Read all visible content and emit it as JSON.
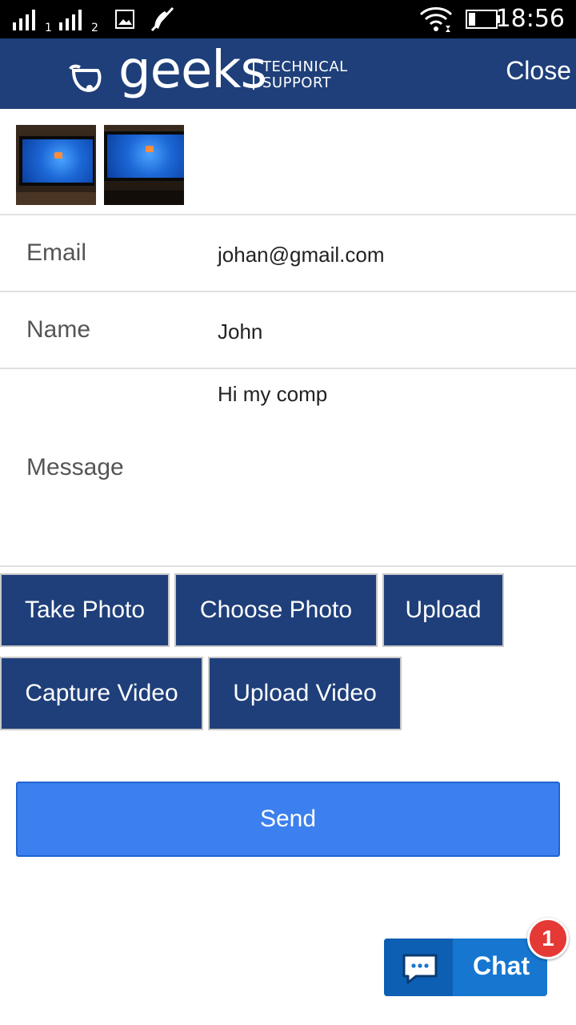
{
  "status_bar": {
    "sim1_label": "1",
    "sim2_label": "2",
    "time": "18:56"
  },
  "header": {
    "logo_word": "geeks",
    "logo_sub_line1": "TECHNICAL",
    "logo_sub_line2": "SUPPORT",
    "close_label": "Close"
  },
  "form": {
    "email_label": "Email",
    "email_value": "johan@gmail.com",
    "name_label": "Name",
    "name_value": "John",
    "message_label": "Message",
    "message_value": "Hi my comp"
  },
  "buttons": {
    "take_photo": "Take Photo",
    "choose_photo": "Choose Photo",
    "upload": "Upload",
    "capture_video": "Capture Video",
    "upload_video": "Upload Video",
    "send": "Send"
  },
  "chat": {
    "label": "Chat",
    "badge_count": "1"
  },
  "colors": {
    "header_bg": "#1f3f7a",
    "button_bg": "#1f3f7a",
    "send_bg": "#3b80ee",
    "chat_bg": "#1676d0",
    "badge_bg": "#e53935"
  }
}
